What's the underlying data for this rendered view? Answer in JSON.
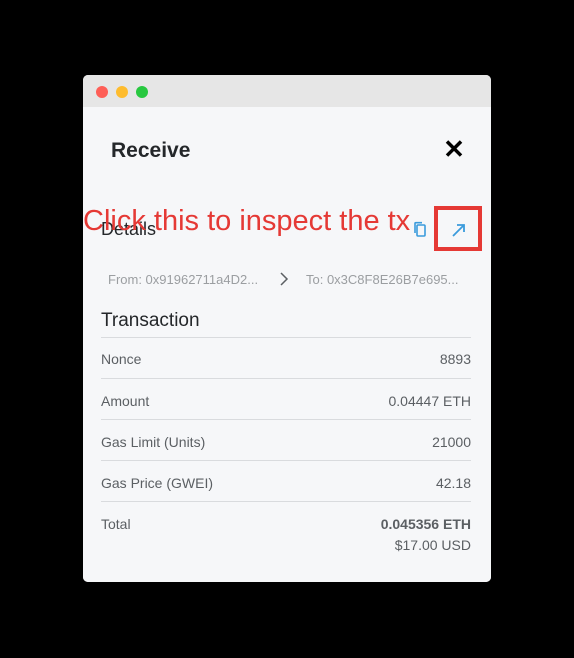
{
  "window": {
    "colors": {
      "close": "#fe5f57",
      "minimize": "#febc2e",
      "maximize": "#28c840"
    }
  },
  "header": {
    "title": "Receive",
    "close_icon": "✕"
  },
  "details": {
    "label": "Details",
    "copy_icon": "copy-icon",
    "open_icon": "external-link-icon",
    "from": "From: 0x91962711a4D2...",
    "to": "To: 0x3C8F8E26B7e695..."
  },
  "annotation": {
    "text": "Click this to inspect the tx",
    "color": "#e53935"
  },
  "transaction": {
    "title": "Transaction",
    "rows": [
      {
        "label": "Nonce",
        "value": "8893"
      },
      {
        "label": "Amount",
        "value": "0.04447 ETH"
      },
      {
        "label": "Gas Limit (Units)",
        "value": "21000"
      },
      {
        "label": "Gas Price (GWEI)",
        "value": "42.18"
      },
      {
        "label": "Total",
        "value": "0.045356 ETH",
        "value2": "$17.00 USD"
      }
    ]
  }
}
